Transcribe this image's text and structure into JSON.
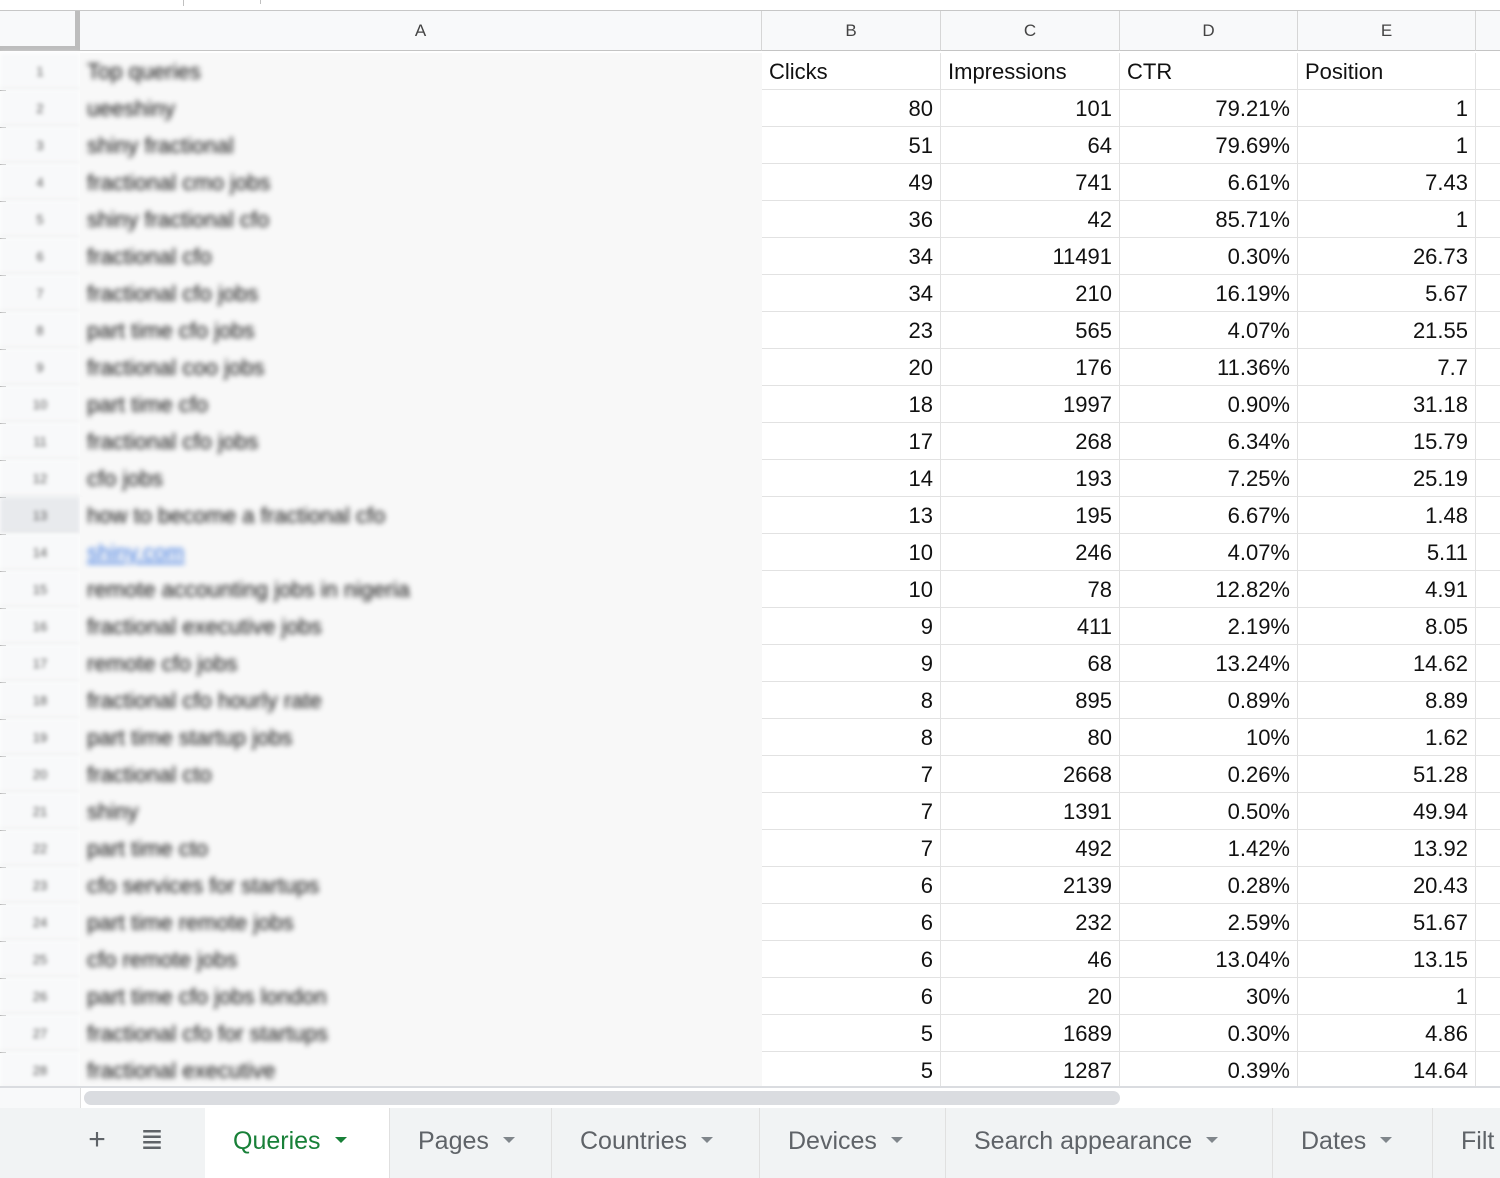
{
  "sheet": {
    "column_headers": [
      "A",
      "B",
      "C",
      "D",
      "E"
    ],
    "header_row": {
      "a": "Top queries",
      "b": "Clicks",
      "c": "Impressions",
      "d": "CTR",
      "e": "Position"
    },
    "rows": [
      {
        "n": "2",
        "query": "ueeshiny",
        "clicks": "80",
        "impressions": "101",
        "ctr": "79.21%",
        "position": "1"
      },
      {
        "n": "3",
        "query": "shiny fractional",
        "clicks": "51",
        "impressions": "64",
        "ctr": "79.69%",
        "position": "1"
      },
      {
        "n": "4",
        "query": "fractional cmo jobs",
        "clicks": "49",
        "impressions": "741",
        "ctr": "6.61%",
        "position": "7.43"
      },
      {
        "n": "5",
        "query": "shiny fractional cfo",
        "clicks": "36",
        "impressions": "42",
        "ctr": "85.71%",
        "position": "1"
      },
      {
        "n": "6",
        "query": "fractional cfo",
        "clicks": "34",
        "impressions": "11491",
        "ctr": "0.30%",
        "position": "26.73"
      },
      {
        "n": "7",
        "query": "fractional cfo jobs",
        "clicks": "34",
        "impressions": "210",
        "ctr": "16.19%",
        "position": "5.67"
      },
      {
        "n": "8",
        "query": "part time cfo jobs",
        "clicks": "23",
        "impressions": "565",
        "ctr": "4.07%",
        "position": "21.55"
      },
      {
        "n": "9",
        "query": "fractional coo jobs",
        "clicks": "20",
        "impressions": "176",
        "ctr": "11.36%",
        "position": "7.7"
      },
      {
        "n": "10",
        "query": "part time cfo",
        "clicks": "18",
        "impressions": "1997",
        "ctr": "0.90%",
        "position": "31.18"
      },
      {
        "n": "11",
        "query": "fractional cfo jobs",
        "clicks": "17",
        "impressions": "268",
        "ctr": "6.34%",
        "position": "15.79"
      },
      {
        "n": "12",
        "query": "cfo jobs",
        "clicks": "14",
        "impressions": "193",
        "ctr": "7.25%",
        "position": "25.19"
      },
      {
        "n": "13",
        "query": "how to become a fractional cfo",
        "clicks": "13",
        "impressions": "195",
        "ctr": "6.67%",
        "position": "1.48"
      },
      {
        "n": "14",
        "query": "shiny.com",
        "clicks": "10",
        "impressions": "246",
        "ctr": "4.07%",
        "position": "5.11",
        "is_link": true
      },
      {
        "n": "15",
        "query": "remote accounting jobs in nigeria",
        "clicks": "10",
        "impressions": "78",
        "ctr": "12.82%",
        "position": "4.91"
      },
      {
        "n": "16",
        "query": "fractional executive jobs",
        "clicks": "9",
        "impressions": "411",
        "ctr": "2.19%",
        "position": "8.05"
      },
      {
        "n": "17",
        "query": "remote cfo jobs",
        "clicks": "9",
        "impressions": "68",
        "ctr": "13.24%",
        "position": "14.62"
      },
      {
        "n": "18",
        "query": "fractional cfo hourly rate",
        "clicks": "8",
        "impressions": "895",
        "ctr": "0.89%",
        "position": "8.89"
      },
      {
        "n": "19",
        "query": "part time startup jobs",
        "clicks": "8",
        "impressions": "80",
        "ctr": "10%",
        "position": "1.62"
      },
      {
        "n": "20",
        "query": "fractional cto",
        "clicks": "7",
        "impressions": "2668",
        "ctr": "0.26%",
        "position": "51.28"
      },
      {
        "n": "21",
        "query": "shiny",
        "clicks": "7",
        "impressions": "1391",
        "ctr": "0.50%",
        "position": "49.94"
      },
      {
        "n": "22",
        "query": "part time cto",
        "clicks": "7",
        "impressions": "492",
        "ctr": "1.42%",
        "position": "13.92"
      },
      {
        "n": "23",
        "query": "cfo services for startups",
        "clicks": "6",
        "impressions": "2139",
        "ctr": "0.28%",
        "position": "20.43"
      },
      {
        "n": "24",
        "query": "part time remote jobs",
        "clicks": "6",
        "impressions": "232",
        "ctr": "2.59%",
        "position": "51.67"
      },
      {
        "n": "25",
        "query": "cfo remote jobs",
        "clicks": "6",
        "impressions": "46",
        "ctr": "13.04%",
        "position": "13.15"
      },
      {
        "n": "26",
        "query": "part time cfo jobs london",
        "clicks": "6",
        "impressions": "20",
        "ctr": "30%",
        "position": "1"
      },
      {
        "n": "27",
        "query": "fractional cfo for startups",
        "clicks": "5",
        "impressions": "1689",
        "ctr": "0.30%",
        "position": "4.86"
      },
      {
        "n": "28",
        "query": "fractional executive",
        "clicks": "5",
        "impressions": "1287",
        "ctr": "0.39%",
        "position": "14.64"
      }
    ]
  },
  "tabbar": {
    "add_sheet_icon": "+",
    "all_sheets_icon": "≣",
    "tabs": [
      {
        "label": "Queries",
        "active": true
      },
      {
        "label": "Pages"
      },
      {
        "label": "Countries"
      },
      {
        "label": "Devices"
      },
      {
        "label": "Search appearance"
      },
      {
        "label": "Dates"
      },
      {
        "label": "Filt"
      }
    ]
  },
  "colors": {
    "active_tab": "#188038",
    "link": "#3b77e0"
  }
}
